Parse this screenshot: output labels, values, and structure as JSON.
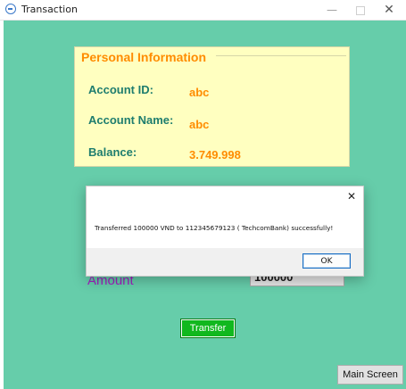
{
  "window": {
    "title": "Transaction",
    "minimize_glyph": "—",
    "close_glyph": "✕"
  },
  "personal_info": {
    "legend": "Personal Information",
    "account_id_label": "Account ID:",
    "account_id_value": "abc",
    "account_name_label": "Account Name:",
    "account_name_value": "abc",
    "balance_label": "Balance:",
    "balance_value": "3.749.998"
  },
  "amount": {
    "label": "Amount",
    "value": "100000"
  },
  "buttons": {
    "transfer": "Transfer",
    "main_screen": "Main Screen"
  },
  "dialog": {
    "close_glyph": "✕",
    "message": "Transferred 100000 VND to 112345679123 ( TechcomBank) successfully!",
    "ok": "OK"
  },
  "colors": {
    "background": "#66cdaa",
    "panel": "#ffffc0",
    "legend": "#ff8c00",
    "label": "#1e7d6e",
    "amount_label": "#a020c0",
    "transfer_button": "#11b81e"
  },
  "icons": {
    "app": "globe-icon",
    "dialog_close": "close-icon"
  }
}
